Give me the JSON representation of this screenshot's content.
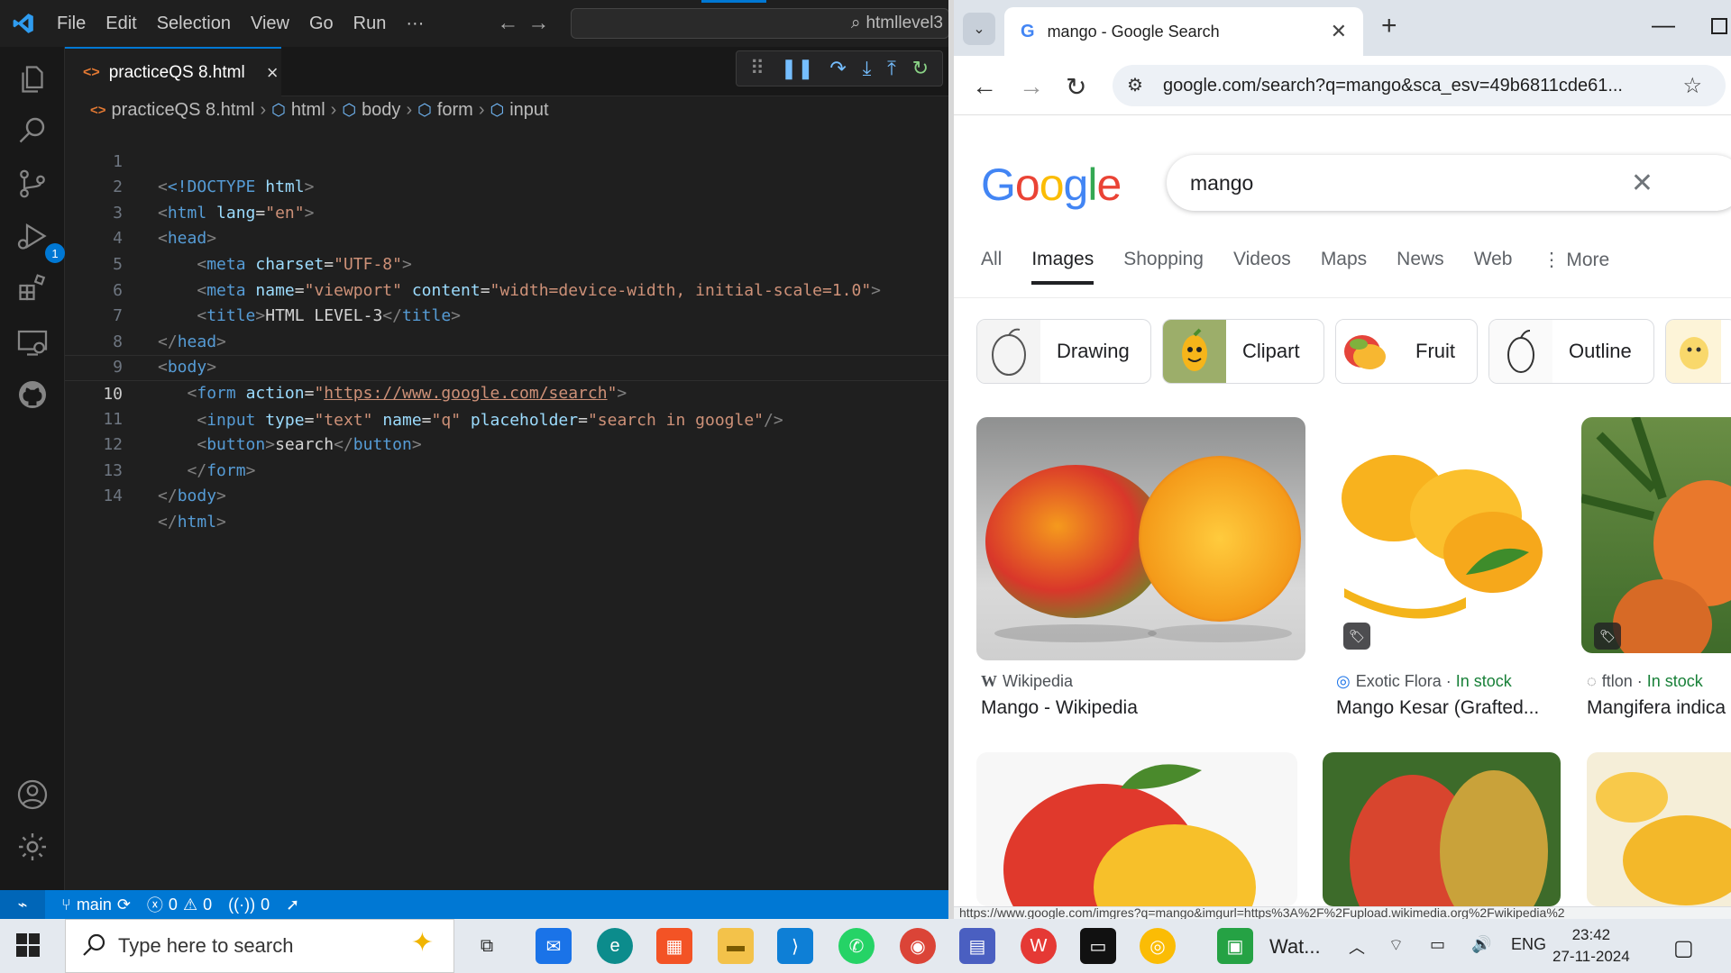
{
  "vscode": {
    "menu": [
      "File",
      "Edit",
      "Selection",
      "View",
      "Go",
      "Run",
      "···"
    ],
    "command_center": "htmllevel3",
    "run_badge": "1",
    "tab": {
      "label": "practiceQS 8.html"
    },
    "breadcrumb": [
      "practiceQS 8.html",
      "html",
      "body",
      "form",
      "input"
    ],
    "line_numbers": [
      "1",
      "2",
      "3",
      "4",
      "5",
      "6",
      "7",
      "8",
      "9",
      "10",
      "11",
      "12",
      "13",
      "14"
    ],
    "code": {
      "l1_doctype": "<!DOCTYPE",
      "l1_html": "html",
      "l2_lang": "\"en\"",
      "l4_charset": "\"UTF-8\"",
      "l5_name": "\"viewport\"",
      "l5_content": "\"width=device-width, initial-scale=1.0\"",
      "l6_title_text": "HTML LEVEL-3",
      "l9_action": "https://www.google.com/search",
      "l10_type": "\"text\"",
      "l10_name": "\"q\"",
      "l10_placeholder": "\"search in google\"",
      "l11_button_text": "search"
    },
    "status": {
      "branch": "main",
      "errors": "0",
      "warnings": "0",
      "ports": "0"
    }
  },
  "chrome": {
    "tab_title": "mango - Google Search",
    "url": "google.com/search?q=mango&sca_esv=49b6811cde61...",
    "query": "mango",
    "logo": "Google",
    "nav_tabs": [
      "All",
      "Images",
      "Shopping",
      "Videos",
      "Maps",
      "News",
      "Web",
      "More"
    ],
    "chips": [
      "Drawing",
      "Clipart",
      "Fruit",
      "Outline"
    ],
    "results": [
      {
        "source": "Wikipedia",
        "stock": "",
        "title": "Mango - Wikipedia"
      },
      {
        "source": "Exotic Flora",
        "stock": "In stock",
        "title": "Mango Kesar (Grafted..."
      },
      {
        "source": "ftlon",
        "stock": "In stock",
        "title": "Mangifera indica"
      }
    ],
    "status_url": "https://www.google.com/imgres?q=mango&imgurl=https%3A%2F%2Fupload.wikimedia.org%2Fwikipedia%2"
  },
  "taskbar": {
    "search_placeholder": "Type here to search",
    "whatsapp_label": "Wat...",
    "language": "ENG",
    "time": "23:42",
    "date": "27-11-2024"
  },
  "colors": {
    "vscode_blue": "#0078d4",
    "google_green": "#188038"
  }
}
